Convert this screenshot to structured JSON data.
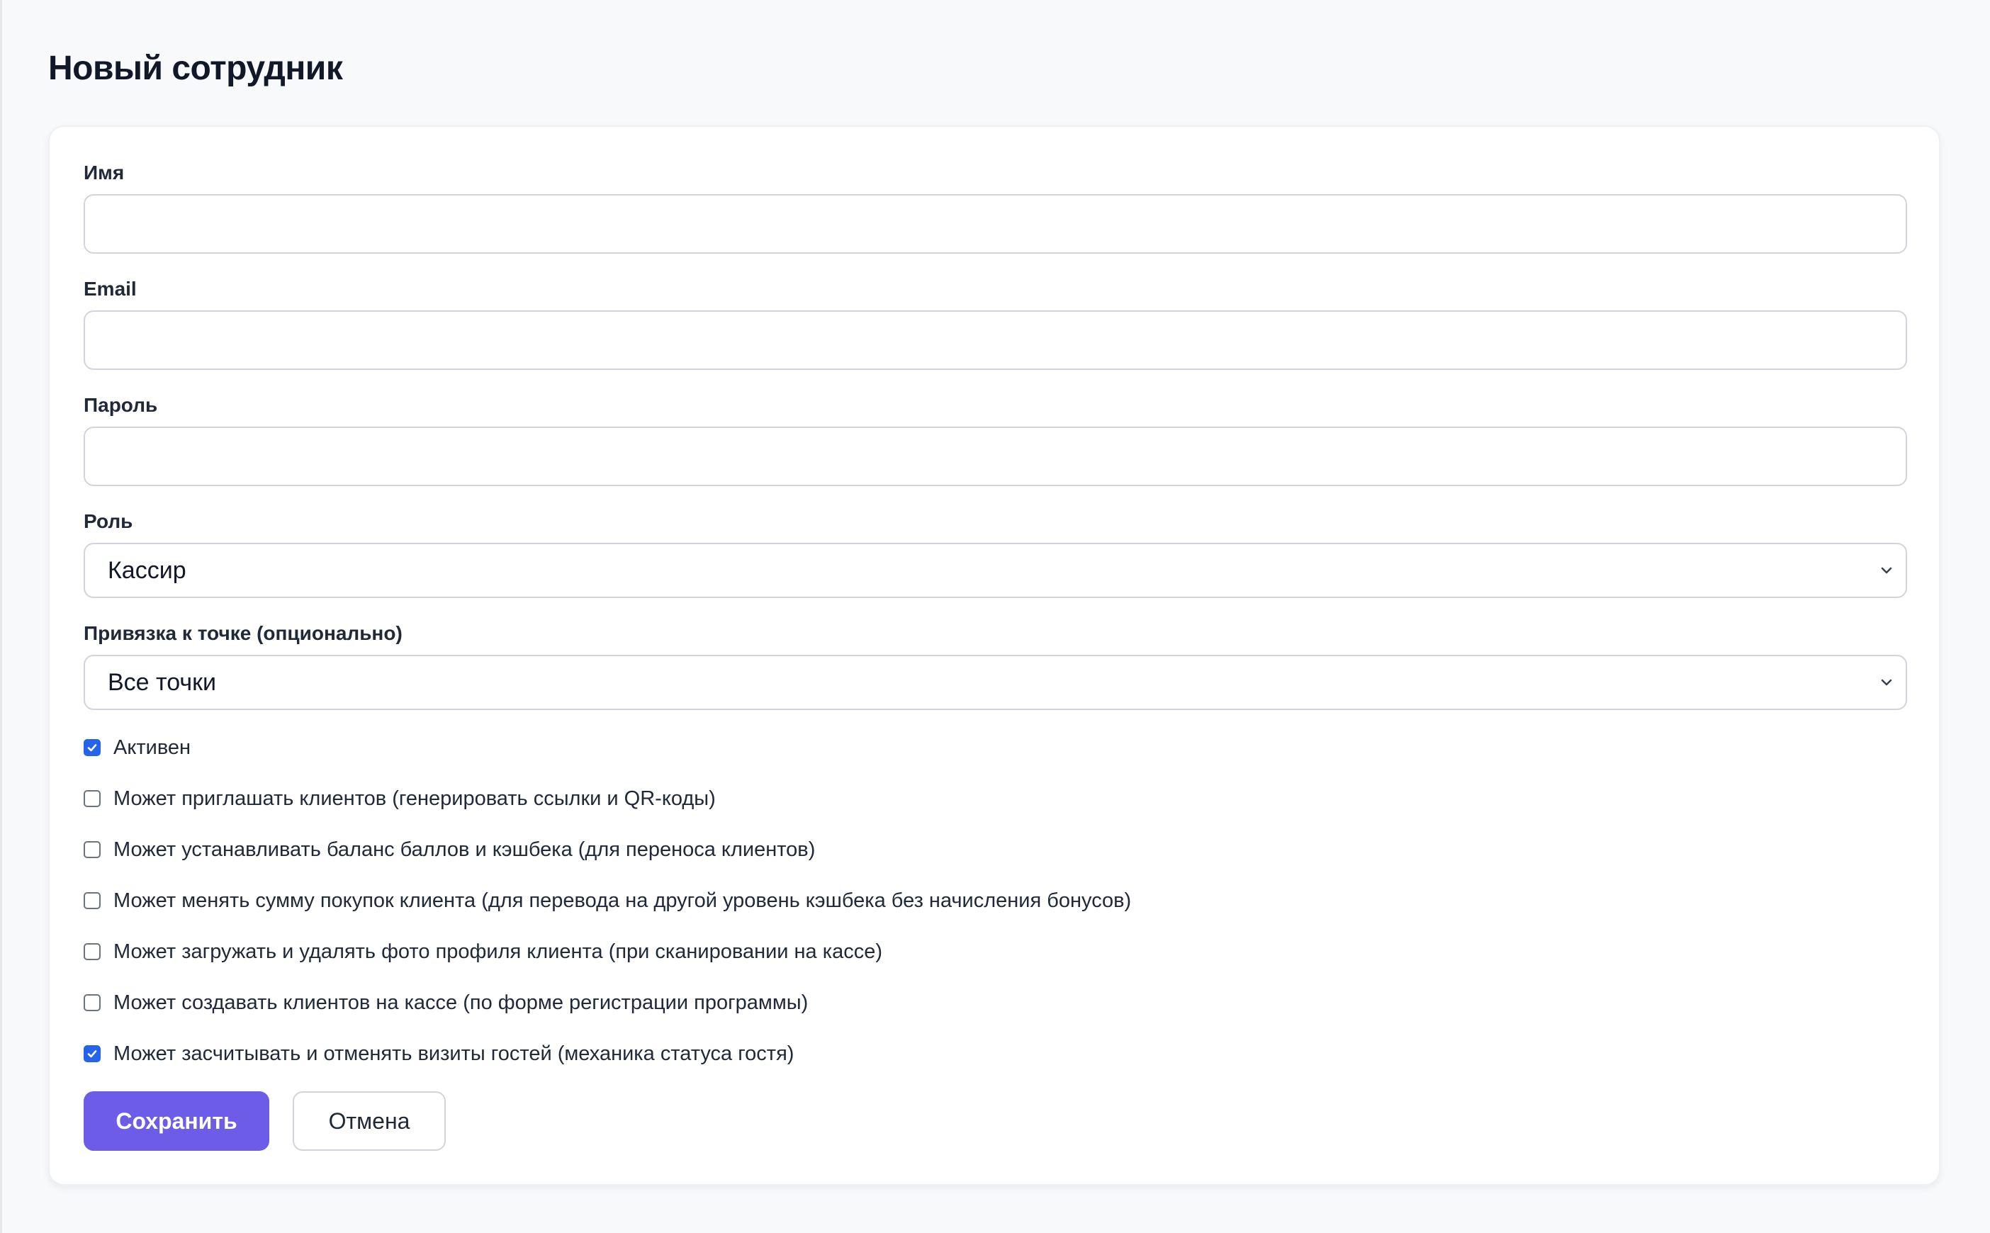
{
  "page": {
    "title": "Новый сотрудник"
  },
  "form": {
    "name": {
      "label": "Имя",
      "value": ""
    },
    "email": {
      "label": "Email",
      "value": ""
    },
    "password": {
      "label": "Пароль",
      "value": ""
    },
    "role": {
      "label": "Роль",
      "selected": "Кассир"
    },
    "location": {
      "label": "Привязка к точке (опционально)",
      "selected": "Все точки"
    },
    "checkboxes": [
      {
        "label": "Активен",
        "checked": true
      },
      {
        "label": "Может приглашать клиентов (генерировать ссылки и QR-коды)",
        "checked": false
      },
      {
        "label": "Может устанавливать баланс баллов и кэшбека (для переноса клиентов)",
        "checked": false
      },
      {
        "label": "Может менять сумму покупок клиента (для перевода на другой уровень кэшбека без начисления бонусов)",
        "checked": false
      },
      {
        "label": "Может загружать и удалять фото профиля клиента (при сканировании на кассе)",
        "checked": false
      },
      {
        "label": "Может создавать клиентов на кассе (по форме регистрации программы)",
        "checked": false
      },
      {
        "label": "Может засчитывать и отменять визиты гостей (механика статуса гостя)",
        "checked": true
      }
    ],
    "save_label": "Сохранить",
    "cancel_label": "Отмена"
  },
  "colors": {
    "primary": "#6c5ce7",
    "checkbox_checked": "#2563eb",
    "page_background": "#f8f9fb",
    "card_background": "#ffffff"
  },
  "icons": {
    "select_arrow": "chevron-down-icon",
    "checkbox_mark": "checkmark-icon"
  }
}
